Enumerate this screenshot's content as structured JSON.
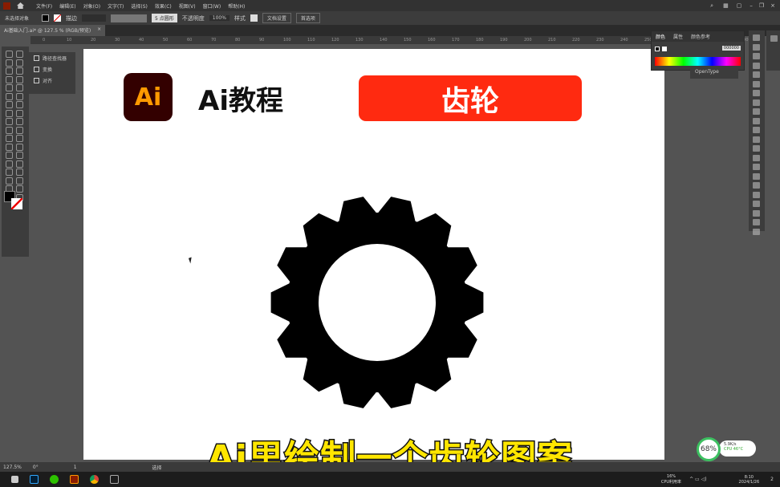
{
  "app": {
    "logo": "Ai"
  },
  "menu": [
    "文件(F)",
    "编辑(E)",
    "对象(O)",
    "文字(T)",
    "选择(S)",
    "效果(C)",
    "视图(V)",
    "窗口(W)",
    "帮助(H)"
  ],
  "control": {
    "selection": "未选择对象",
    "stroke_label": "描边",
    "brush": "5 点圆形",
    "opacity_label": "不透明度",
    "opacity": "100%",
    "style_label": "样式",
    "doc_setup": "文档设置",
    "prefs": "首选项"
  },
  "tab": {
    "title": "Ai基础入门.ai* @ 127.5 % (RGB/预览)",
    "close": "×"
  },
  "ruler": [
    "0",
    "10",
    "20",
    "30",
    "40",
    "50",
    "60",
    "70",
    "80",
    "90",
    "100",
    "110",
    "120",
    "130",
    "140",
    "150",
    "160",
    "170",
    "180",
    "190",
    "200",
    "210",
    "220",
    "230",
    "240",
    "250",
    "260",
    "270",
    "280",
    "290"
  ],
  "left_panel": [
    "路径查找器",
    "变换",
    "对齐"
  ],
  "canvas": {
    "logo": "Ai",
    "title": "Ai教程",
    "banner": "齿轮",
    "subtitle": "Ai里绘制一个齿轮图案"
  },
  "color_panel": {
    "tabs": [
      "颜色",
      "属性",
      "颜色参考"
    ],
    "hex": "000000"
  },
  "opentype": "OpenType",
  "status": {
    "zoom": "127.5%",
    "rotate": "0°",
    "artboard": "1",
    "tool": "选择"
  },
  "widget": {
    "percent": "68%",
    "speed": "5.9K/s",
    "cpu": "CPU 46°C"
  },
  "taskbar": {
    "cpu": "16%",
    "cpu_label": "CPU利用率",
    "time": "8:10",
    "date": "2024/1/26",
    "notif": "2"
  },
  "colors": {
    "accent_red": "#ff2a10",
    "subtitle_yellow": "#ffe600",
    "ai_orange": "#ff9a00"
  }
}
